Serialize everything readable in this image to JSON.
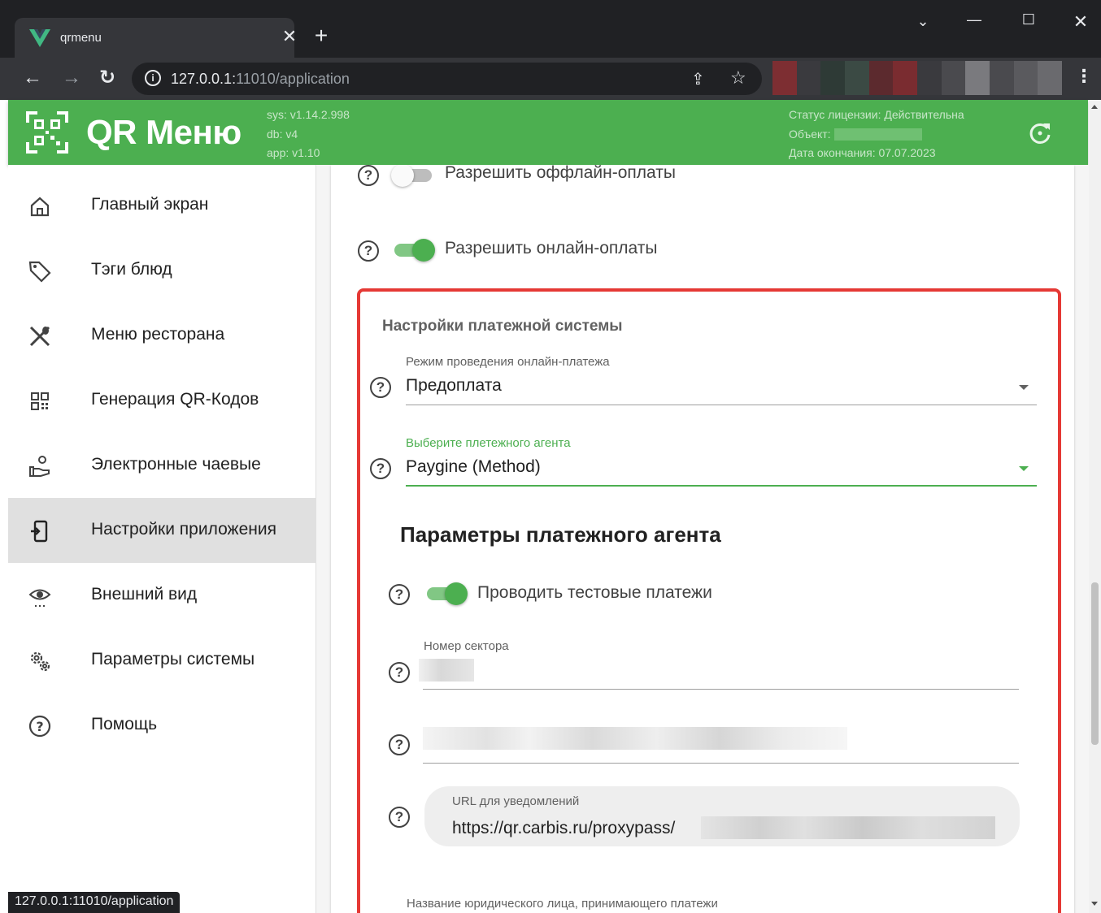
{
  "browser": {
    "tab_title": "qrmenu",
    "url_host": "127.0.0.1:",
    "url_rest": "11010/application",
    "status_url": "127.0.0.1:11010/application"
  },
  "header": {
    "logo_text": "QR Меню",
    "sys_version": "sys: v1.14.2.998",
    "db_version": "db: v4",
    "app_version": "app: v1.10",
    "license_status": "Статус лицензии: Действительна",
    "object_label": "Объект:",
    "expiry": "Дата окончания: 07.07.2023"
  },
  "sidebar": {
    "items": [
      {
        "label": "Главный экран",
        "icon": "home-icon"
      },
      {
        "label": "Тэги блюд",
        "icon": "tag-icon"
      },
      {
        "label": "Меню ресторана",
        "icon": "cutlery-icon"
      },
      {
        "label": "Генерация QR-Кодов",
        "icon": "qr-code-icon"
      },
      {
        "label": "Электронные чаевые",
        "icon": "tip-hand-icon"
      },
      {
        "label": "Настройки приложения",
        "icon": "app-settings-icon",
        "active": true
      },
      {
        "label": "Внешний вид",
        "icon": "eye-icon"
      },
      {
        "label": "Параметры системы",
        "icon": "gears-icon"
      },
      {
        "label": "Помощь",
        "icon": "help-icon"
      }
    ]
  },
  "settings": {
    "offline_payments": {
      "label": "Разрешить оффлайн-оплаты",
      "enabled": false
    },
    "online_payments": {
      "label": "Разрешить онлайн-оплаты",
      "enabled": true
    },
    "payment_system": {
      "title": "Настройки платежной системы",
      "mode_label": "Режим проведения онлайн-платежа",
      "mode_value": "Предоплата",
      "agent_label": "Выберите плетежного агента",
      "agent_value": "Paygine (Method)"
    },
    "agent_params": {
      "title": "Параметры платежного агента",
      "test_payments": {
        "label": "Проводить тестовые платежи",
        "enabled": true
      },
      "sector_label": "Номер сектора",
      "notify_url_label": "URL для уведомлений",
      "notify_url_value": "https://qr.carbis.ru/proxypass/"
    },
    "legal_entity_label": "Название юридического лица, принимающего платежи"
  },
  "colors": {
    "brand_green": "#4caf50",
    "highlight_red": "#e53935"
  }
}
